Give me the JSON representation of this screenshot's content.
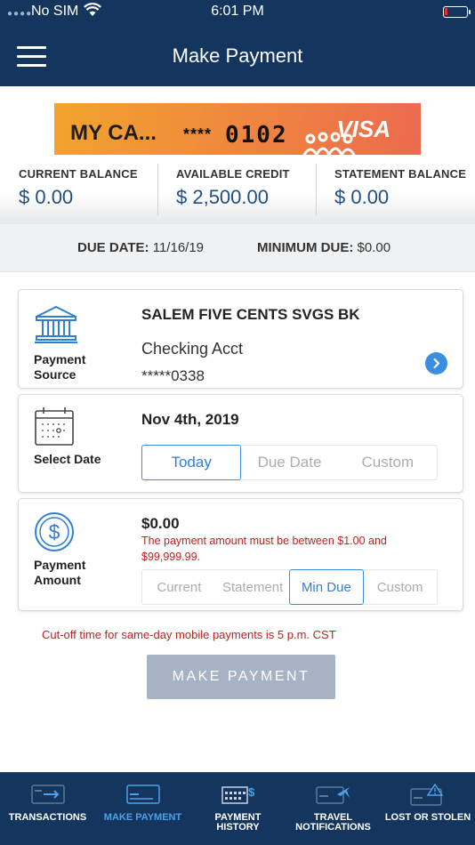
{
  "status_bar": {
    "carrier": "No SIM",
    "time": "6:01 PM"
  },
  "header": {
    "title": "Make Payment",
    "menu_icon": "hamburger-menu-icon"
  },
  "card": {
    "name": "MY CA...",
    "masked": "****",
    "last4": "0102",
    "network": "VISA"
  },
  "balances": [
    {
      "label": "CURRENT BALANCE",
      "value": "$ 0.00"
    },
    {
      "label": "AVAILABLE CREDIT",
      "value": "$ 2,500.00"
    },
    {
      "label": "STATEMENT BALANCE",
      "value": "$ 0.00"
    }
  ],
  "due": {
    "date_label": "DUE DATE:",
    "date_value": "11/16/19",
    "min_label": "MINIMUM DUE:",
    "min_value": "$0.00"
  },
  "payment_source": {
    "label_line1": "Payment",
    "label_line2": "Source",
    "bank": "SALEM FIVE CENTS SVGS BK",
    "account_type": "Checking Acct",
    "account_number": "*****0338"
  },
  "select_date": {
    "label": "Select Date",
    "value": "Nov 4th, 2019",
    "options": [
      "Today",
      "Due Date",
      "Custom"
    ],
    "selected": "Today"
  },
  "payment_amount": {
    "label_line1": "Payment",
    "label_line2": "Amount",
    "value": "$0.00",
    "error": "The payment amount must be between $1.00 and $99,999.99.",
    "options": [
      "Current",
      "Statement",
      "Min Due",
      "Custom"
    ],
    "selected": "Min Due"
  },
  "cutoff_note": "Cut-off time for same-day mobile payments is 5 p.m. CST",
  "make_payment_button": "MAKE PAYMENT",
  "nav": {
    "tabs": [
      {
        "label": "TRANSACTIONS",
        "label2": "",
        "icon": "card-transfer-icon"
      },
      {
        "label": "MAKE PAYMENT",
        "label2": "",
        "icon": "card-icon",
        "active": true
      },
      {
        "label": "PAYMENT",
        "label2": "HISTORY",
        "icon": "calendar-dollar-icon"
      },
      {
        "label": "TRAVEL",
        "label2": "NOTIFICATIONS",
        "icon": "card-plane-icon"
      },
      {
        "label": "LOST OR STOLEN",
        "label2": "",
        "icon": "card-alert-icon"
      }
    ]
  },
  "colors": {
    "navy": "#14365e",
    "accent": "#3a8ee0",
    "error": "#c0201e",
    "button_disabled": "#a6b3c5"
  }
}
